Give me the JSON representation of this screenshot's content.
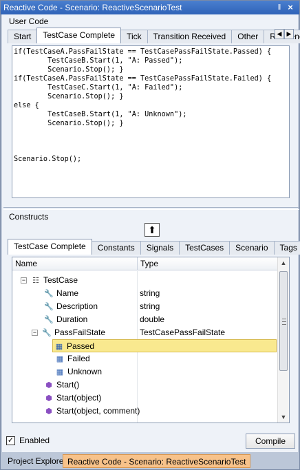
{
  "window": {
    "title": "Reactive Code - Scenario: ReactiveScenarioTest",
    "pin_glyph": "‖",
    "close_glyph": "×"
  },
  "user_code": {
    "group_label": "User Code",
    "tabs": [
      "Start",
      "TestCase Complete",
      "Tick",
      "Transition Received",
      "Other",
      "Reference"
    ],
    "active_tab": "TestCase Complete",
    "code": "if(TestCaseA.PassFailState == TestCasePassFailState.Passed) {\n        TestCaseB.Start(1, \"A: Passed\");\n        Scenario.Stop(); }\nif(TestCaseA.PassFailState == TestCasePassFailState.Failed) {\n        TestCaseC.Start(1, \"A: Failed\");\n        Scenario.Stop(); }\nelse {\n        TestCaseB.Start(1, \"A: Unknown\");\n        Scenario.Stop(); }\n\n\n\nScenario.Stop();"
  },
  "constructs": {
    "group_label": "Constructs",
    "insert_glyph": "⬆",
    "tabs": [
      "TestCase Complete",
      "Constants",
      "Signals",
      "TestCases",
      "Scenario",
      "Tags"
    ],
    "active_tab": "TestCase Complete",
    "columns": [
      "Name",
      "Type"
    ],
    "rows": [
      {
        "name": "TestCase",
        "type": "",
        "icon": "class-icon"
      },
      {
        "name": "Name",
        "type": "string",
        "icon": "property-icon"
      },
      {
        "name": "Description",
        "type": "string",
        "icon": "property-icon"
      },
      {
        "name": "Duration",
        "type": "double",
        "icon": "property-icon"
      },
      {
        "name": "PassFailState",
        "type": "TestCasePassFailState",
        "icon": "property-icon"
      },
      {
        "name": "Passed",
        "type": "",
        "icon": "enum-value-icon",
        "selected": true
      },
      {
        "name": "Failed",
        "type": "",
        "icon": "enum-value-icon"
      },
      {
        "name": "Unknown",
        "type": "",
        "icon": "enum-value-icon"
      },
      {
        "name": "Start()",
        "type": "",
        "icon": "method-icon"
      },
      {
        "name": "Start(object)",
        "type": "",
        "icon": "method-icon"
      },
      {
        "name": "Start(object, comment)",
        "type": "",
        "icon": "method-icon"
      }
    ]
  },
  "footer": {
    "enabled_label": "Enabled",
    "enabled_checked": true,
    "compile_label": "Compile"
  },
  "bottom_tabs": [
    {
      "label": "Project Explorer",
      "active": false
    },
    {
      "label": "Reactive Code - Scenario: ReactiveScenarioTest",
      "active": true
    }
  ],
  "colors": {
    "title_bar": "#2f63b8",
    "selection": "#f9e98f",
    "active_bottom_tab": "#f7c28a"
  }
}
